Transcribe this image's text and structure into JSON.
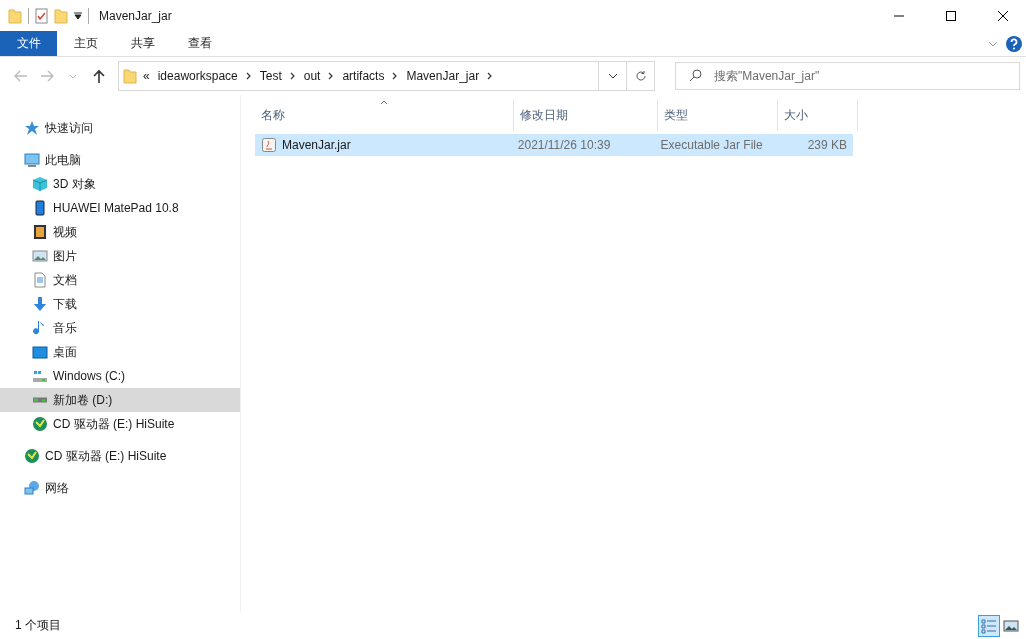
{
  "window": {
    "title": "MavenJar_jar"
  },
  "ribbon_tabs": [
    {
      "label": "文件",
      "selected": true
    },
    {
      "label": "主页",
      "selected": false
    },
    {
      "label": "共享",
      "selected": false
    },
    {
      "label": "查看",
      "selected": false
    }
  ],
  "address": {
    "overflow": "«",
    "crumbs": [
      "ideaworkspace",
      "Test",
      "out",
      "artifacts",
      "MavenJar_jar"
    ]
  },
  "search": {
    "placeholder": "搜索\"MavenJar_jar\""
  },
  "sidebar": {
    "items": [
      {
        "label": "快速访问",
        "kind": "star",
        "selected": false
      },
      {
        "label": "此电脑",
        "kind": "pc",
        "selected": false,
        "children": [
          {
            "label": "3D 对象",
            "kind": "cube",
            "selected": false
          },
          {
            "label": "HUAWEI MatePad 10.8",
            "kind": "phone",
            "selected": false
          },
          {
            "label": "视频",
            "kind": "film",
            "selected": false
          },
          {
            "label": "图片",
            "kind": "picture",
            "selected": false
          },
          {
            "label": "文档",
            "kind": "doc",
            "selected": false
          },
          {
            "label": "下载",
            "kind": "download",
            "selected": false
          },
          {
            "label": "音乐",
            "kind": "music",
            "selected": false
          },
          {
            "label": "桌面",
            "kind": "desktop",
            "selected": false
          },
          {
            "label": "Windows (C:)",
            "kind": "drive",
            "selected": false
          },
          {
            "label": "新加卷 (D:)",
            "kind": "usb",
            "selected": true
          },
          {
            "label": "CD 驱动器 (E:) HiSuite",
            "kind": "cd",
            "selected": false
          }
        ]
      },
      {
        "label": "CD 驱动器 (E:) HiSuite",
        "kind": "cd",
        "selected": false
      },
      {
        "label": "网络",
        "kind": "network",
        "selected": false
      }
    ]
  },
  "table": {
    "columns": [
      "名称",
      "修改日期",
      "类型",
      "大小"
    ],
    "rows": [
      {
        "name": "MavenJar.jar",
        "date": "2021/11/26 10:39",
        "type": "Executable Jar File",
        "size": "239 KB",
        "selected": true
      }
    ]
  },
  "status_bar": {
    "text": "1 个项目",
    "views": [
      {
        "kind": "details",
        "selected": true
      },
      {
        "kind": "large",
        "selected": false
      }
    ]
  }
}
